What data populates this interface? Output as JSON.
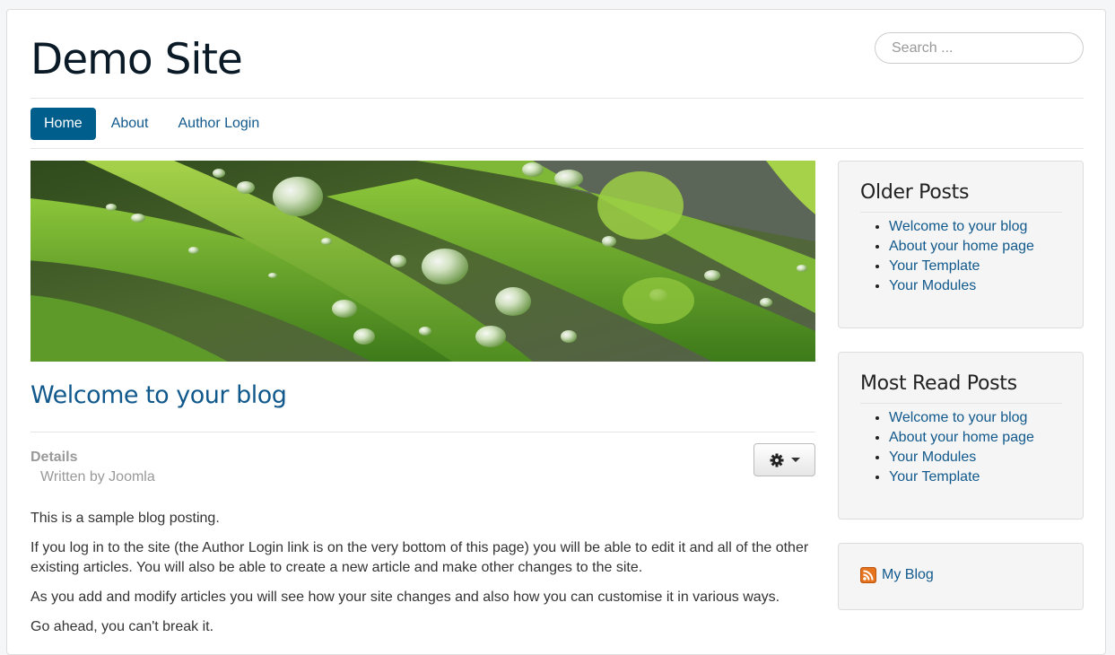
{
  "site": {
    "title": "Demo Site"
  },
  "search": {
    "placeholder": "Search ..."
  },
  "nav": {
    "items": [
      {
        "label": "Home",
        "active": true
      },
      {
        "label": "About",
        "active": false
      },
      {
        "label": "Author Login",
        "active": false
      }
    ]
  },
  "hero": {
    "icon": "grass-with-water-droplets-image"
  },
  "article": {
    "title": "Welcome to your blog",
    "details_label": "Details",
    "author_line": "Written by Joomla",
    "tools_icon": "gear-icon",
    "paragraphs": [
      "This is a sample blog posting.",
      "If you log in to the site (the Author Login link is on the very bottom of this page) you will be able to edit it and all of the other existing articles. You will also be able to create a new article and make other changes to the site.",
      "As you add and modify articles you will see how your site changes and also how you can customise it in various ways.",
      "Go ahead, you can't break it."
    ]
  },
  "sidebar": {
    "older_posts": {
      "title": "Older Posts",
      "items": [
        "Welcome to your blog",
        "About your home page",
        "Your Template",
        "Your Modules"
      ]
    },
    "most_read": {
      "title": "Most Read Posts",
      "items": [
        "Welcome to your blog",
        "About your home page",
        "Your Modules",
        "Your Template"
      ]
    },
    "feed": {
      "label": "My Blog",
      "icon": "rss-icon"
    }
  },
  "colors": {
    "link": "#11598c",
    "nav_active_bg": "#005e8d",
    "muted": "#999999"
  }
}
